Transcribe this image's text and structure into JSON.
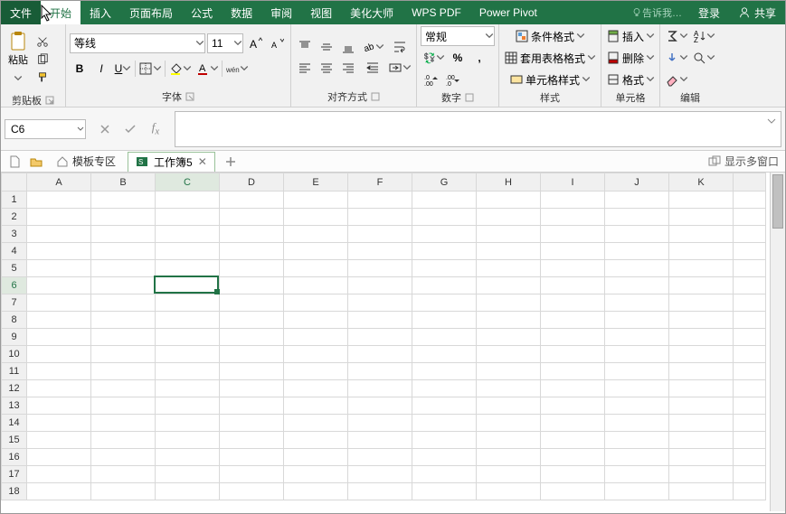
{
  "menu": {
    "tabs": [
      "文件",
      "开始",
      "插入",
      "页面布局",
      "公式",
      "数据",
      "审阅",
      "视图",
      "美化大师",
      "WPS PDF",
      "Power Pivot"
    ],
    "hint": "告诉我…",
    "login": "登录",
    "share": "共享"
  },
  "ribbon": {
    "clipboard": {
      "paste": "粘贴",
      "label": "剪贴板"
    },
    "font": {
      "name": "等线",
      "size": "11",
      "label": "字体"
    },
    "align": {
      "label": "对齐方式"
    },
    "number": {
      "format": "常规",
      "label": "数字"
    },
    "styles": {
      "cond": "条件格式",
      "table": "套用表格格式",
      "cell": "单元格样式",
      "label": "样式"
    },
    "cells": {
      "insert": "插入",
      "delete": "删除",
      "format": "格式",
      "label": "单元格"
    },
    "edit": {
      "label": "编辑"
    }
  },
  "namebox": "C6",
  "tabs": {
    "template": "模板专区",
    "doc": "工作簿5",
    "multi": "显示多窗口"
  },
  "cols": [
    "A",
    "B",
    "C",
    "D",
    "E",
    "F",
    "G",
    "H",
    "I",
    "J",
    "K"
  ],
  "rows": [
    "1",
    "2",
    "3",
    "4",
    "5",
    "6",
    "7",
    "8",
    "9",
    "10",
    "11",
    "12",
    "13",
    "14",
    "15",
    "16",
    "17",
    "18"
  ],
  "activeCol": 2,
  "activeRow": 5,
  "colors": {
    "accent": "#217346"
  }
}
